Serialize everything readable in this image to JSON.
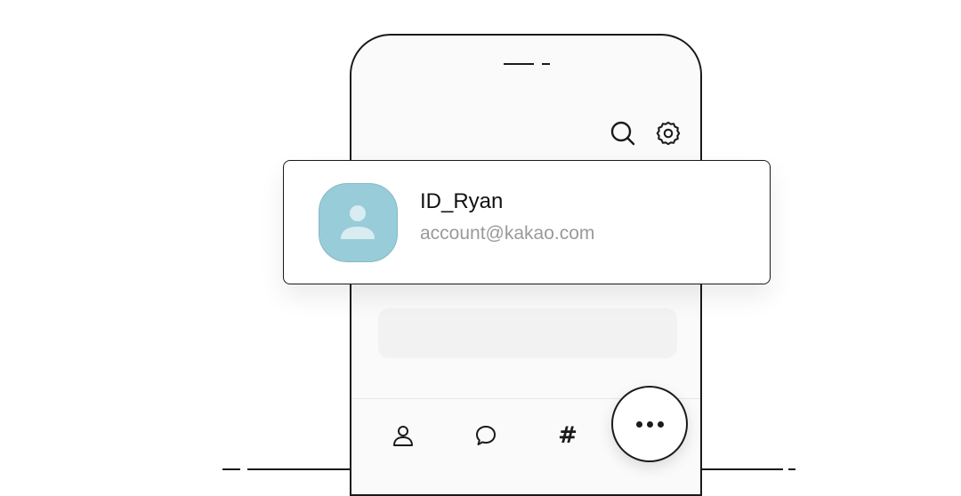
{
  "account": {
    "id": "ID_Ryan",
    "email": "account@kakao.com"
  },
  "icons": {
    "search": "search-icon",
    "settings": "gear-icon",
    "avatar": "person-icon",
    "friends": "person-icon",
    "chat": "chat-bubble-icon",
    "hashtag": "hashtag-icon",
    "more": "more-dots-icon"
  },
  "tabs": {
    "hash_label": "#"
  },
  "colors": {
    "avatar_bg": "#98ccd8",
    "text_primary": "#111111",
    "text_secondary": "#9a9a9a"
  }
}
